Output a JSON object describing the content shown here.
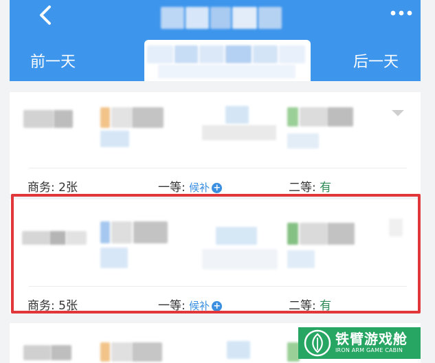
{
  "header": {
    "prev_day_label": "前一天",
    "next_day_label": "后一天"
  },
  "trains": [
    {
      "seats": [
        {
          "label": "商务:",
          "value": "2张"
        },
        {
          "label": "一等:",
          "value": "候补"
        },
        {
          "label": "二等:",
          "value": "有"
        }
      ]
    },
    {
      "seats": [
        {
          "label": "商务:",
          "value": "5张"
        },
        {
          "label": "一等:",
          "value": "候补"
        },
        {
          "label": "二等:",
          "value": "有"
        }
      ]
    }
  ],
  "watermark": {
    "title": "铁臂游戏舱",
    "subtitle": "IRON ARM GAME CABIN"
  },
  "colors": {
    "header_bg": "#3d95ec",
    "highlight": "#e2373a",
    "available_green": "#2e8b57",
    "waitlist_blue": "#3a8fe0",
    "watermark_bg": "#27a562"
  },
  "icons": [
    "back-arrow-icon",
    "more-dots-icon",
    "plus-circle-icon",
    "dropdown-arrow-icon",
    "leaf-logo-icon"
  ]
}
